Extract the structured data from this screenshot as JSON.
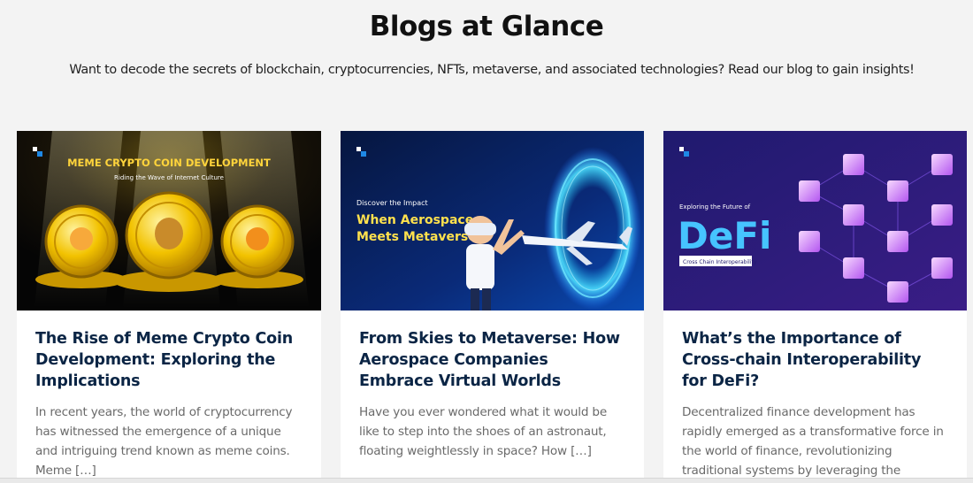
{
  "section": {
    "title": "Blogs at Glance",
    "subtitle": "Want to decode the secrets of blockchain, cryptocurrencies, NFTs, metaverse, and associated technologies? Read our blog to gain insights!"
  },
  "cards": [
    {
      "image": {
        "headline": "MEME CRYPTO COIN DEVELOPMENT",
        "tagline": "Riding the Wave of Internet Culture"
      },
      "title": "The Rise of Meme Crypto Coin Development: Exploring the Implications",
      "excerpt": "In recent years, the world of cryptocurrency has witnessed the emergence of a unique and intriguing trend known as meme coins. Meme […]"
    },
    {
      "image": {
        "kicker": "Discover the Impact",
        "headline_line1": "When Aerospace",
        "headline_line2": "Meets Metaverse"
      },
      "title": "From Skies to Metaverse: How Aerospace Companies Embrace Virtual Worlds",
      "excerpt": "Have you ever wondered what it would be like to step into the shoes of an astronaut, floating weightlessly in space? How […]"
    },
    {
      "image": {
        "kicker": "Exploring the Future of",
        "headline": "DeFi",
        "badge": "Cross Chain Interoperability"
      },
      "title": "What’s the Importance of Cross-chain Interoperability for DeFi?",
      "excerpt": "Decentralized finance development has rapidly emerged as a transformative force in the world of finance, revolutionizing traditional systems by leveraging the"
    }
  ],
  "colors": {
    "page_background": "#f3f3f3",
    "card_title": "#0b2545",
    "excerpt": "#6a6a6a",
    "brand_accent": "#1e88e5"
  }
}
